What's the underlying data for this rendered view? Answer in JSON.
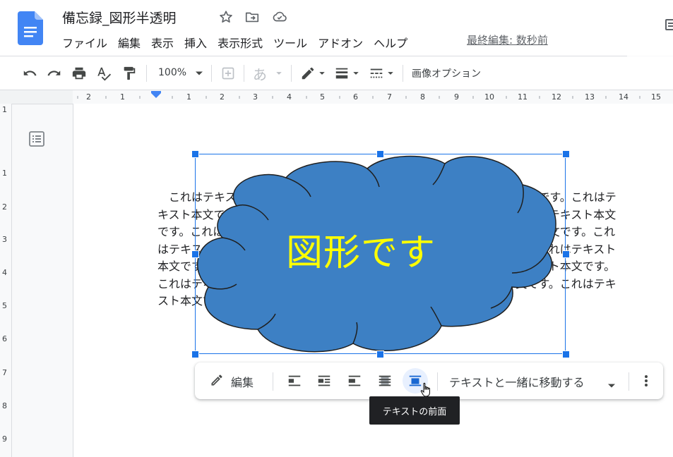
{
  "doc": {
    "title": "備忘録_図形半透明",
    "last_edit": "最終編集: 数秒前"
  },
  "menu": [
    "ファイル",
    "編集",
    "表示",
    "挿入",
    "表示形式",
    "ツール",
    "アドオン",
    "ヘルプ"
  ],
  "toolbar": {
    "zoom": "100%",
    "image_options": "画像オプション",
    "input_char": "あ"
  },
  "ruler": {
    "h_ticks": [
      "2",
      "1",
      "1",
      "2",
      "3",
      "4",
      "5",
      "6",
      "7",
      "8",
      "9",
      "10",
      "11",
      "12",
      "13",
      "14",
      "15"
    ],
    "v_ticks": [
      "1",
      "1",
      "2",
      "3",
      "4",
      "5",
      "6",
      "7",
      "8",
      "9"
    ]
  },
  "body_lines": [
    "　これはテキスト本文です。これはテキスト本文です。これはテキスト本文です。これはテ",
    "キスト本文です。これはテキスト本文です。これはテキスト本文です。これはテキスト本文",
    "です。これはテキスト本文です。これはテキスト本文です。これはテキスト本文です。これ",
    "はテキスト本文です。これはテキスト本文です。これはテキスト本文です。これはテキスト",
    "本文です。これはテキスト本文です。これはテキスト本文です。これはテキスト本文です。",
    "これはテキスト本文です。これはテキスト本文です。これはテキスト本文です。これはテキ",
    "スト本文です。これはテキスト本文です。これはテキスト本文です。"
  ],
  "shape": {
    "text": "図形です",
    "fill": "#3d80c4",
    "text_color": "#ffff00"
  },
  "image_toolbar": {
    "edit_label": "編集",
    "move_option": "テキストと一緒に移動する",
    "tooltip": "テキストの前面"
  },
  "colors": {
    "accent": "#1a73e8",
    "docs_blue": "#4285f4"
  }
}
